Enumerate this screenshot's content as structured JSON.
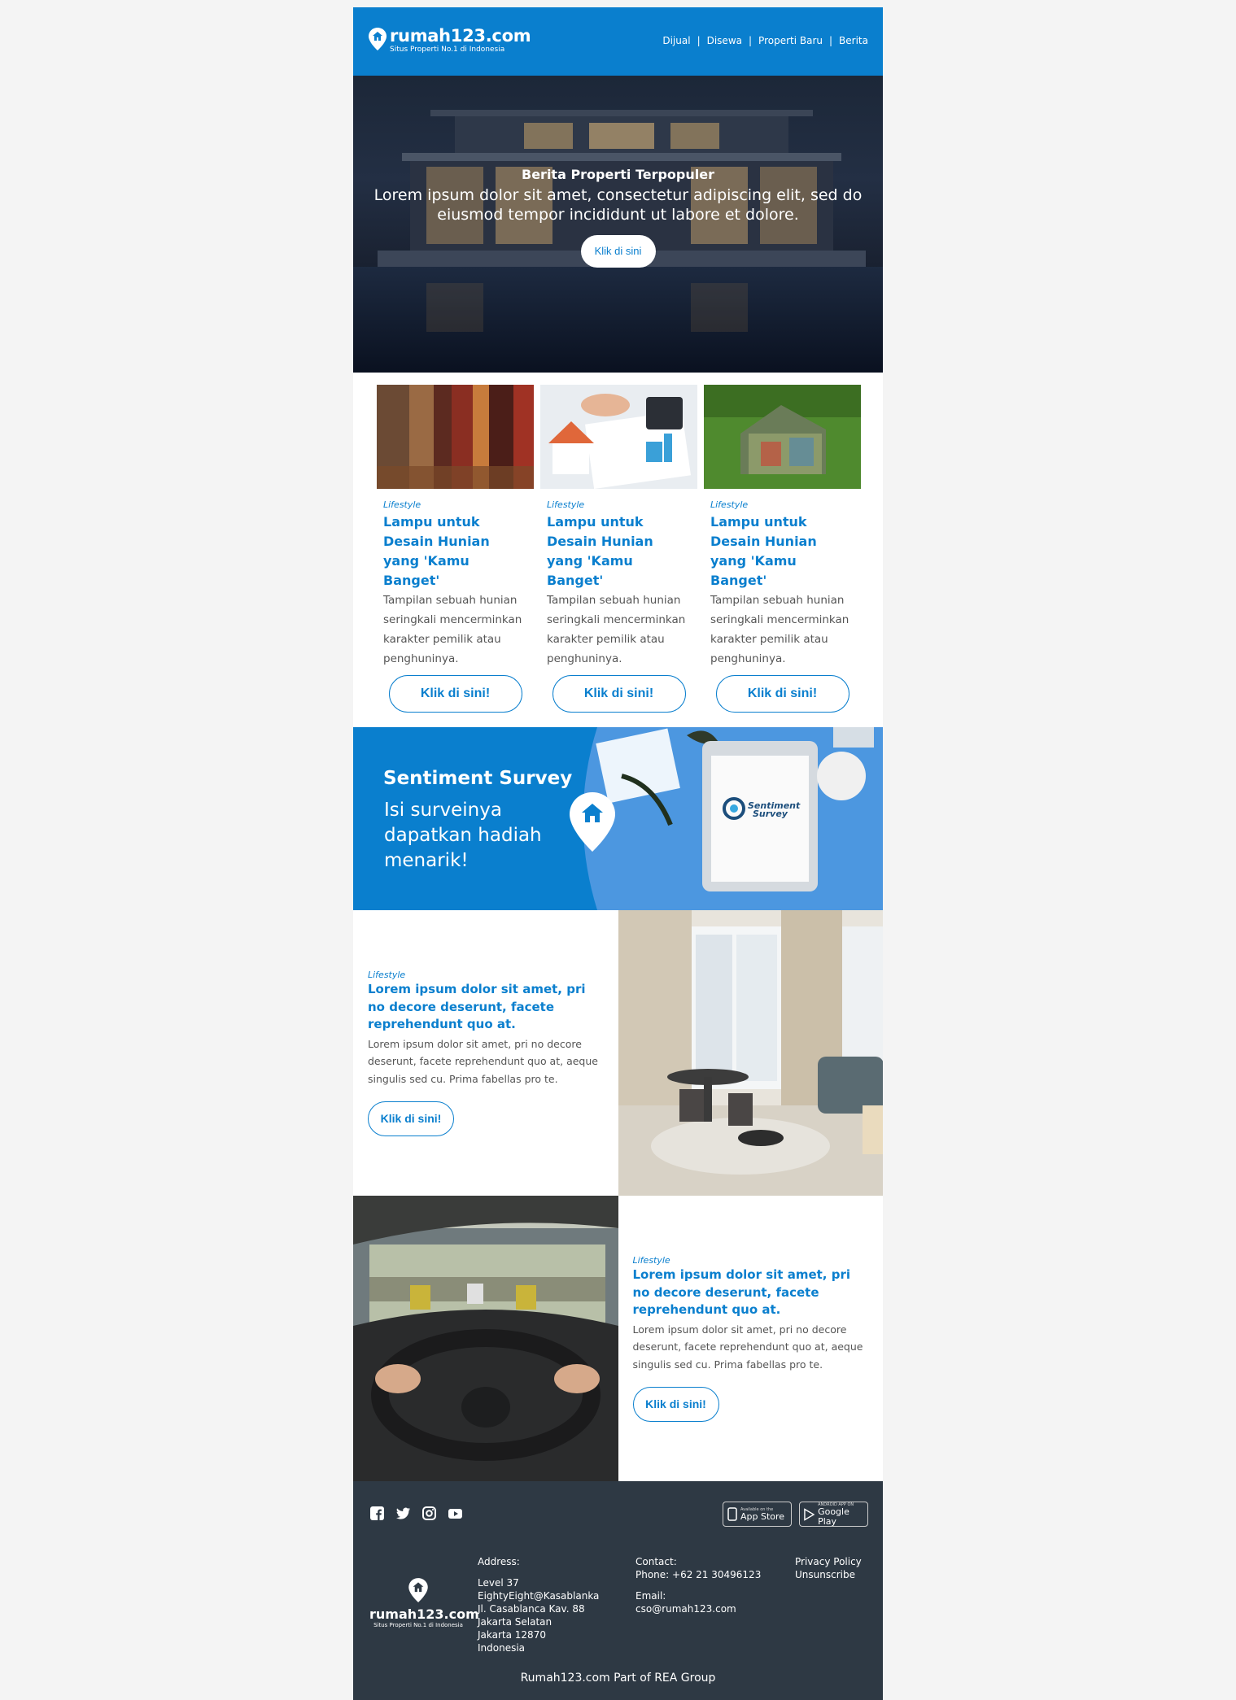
{
  "header": {
    "brand": "rumah123.com",
    "tagline": "Situs Properti No.1 di Indonesia",
    "nav": [
      "Dijual",
      "Disewa",
      "Properti Baru",
      "Berita"
    ],
    "separator": "|"
  },
  "hero": {
    "subtitle": "Berita Properti Terpopuler",
    "body": "Lorem ipsum dolor sit amet, consectetur adipiscing elit, sed do eiusmod tempor incididunt ut labore et dolore.",
    "button": "Klik di sini"
  },
  "articles": [
    {
      "category": "Lifestyle",
      "title": "Lampu untuk Desain Hunian yang 'Kamu Banget'",
      "desc": "Tampilan sebuah hunian seringkali mencerminkan karakter pemilik atau penghuninya.",
      "button": "Klik di sini!"
    },
    {
      "category": "Lifestyle",
      "title": "Lampu untuk Desain Hunian yang 'Kamu Banget'",
      "desc": "Tampilan sebuah hunian seringkali mencerminkan karakter pemilik atau penghuninya.",
      "button": "Klik di sini!"
    },
    {
      "category": "Lifestyle",
      "title": "Lampu untuk Desain Hunian yang 'Kamu Banget'",
      "desc": "Tampilan sebuah hunian seringkali mencerminkan karakter pemilik atau penghuninya.",
      "button": "Klik di sini!"
    }
  ],
  "survey": {
    "title": "Sentiment Survey",
    "text": "Isi surveinya dapatkan hadiah menarik!",
    "logo_text_1": "Sentiment",
    "logo_text_2": "Survey"
  },
  "features": [
    {
      "category": "Lifestyle",
      "title": "Lorem ipsum dolor sit amet, pri no decore deserunt, facete reprehendunt quo at.",
      "desc": "Lorem ipsum dolor sit amet, pri no decore deserunt, facete reprehendunt quo at, aeque singulis sed cu. Prima fabellas pro te.",
      "button": "Klik di sini!"
    },
    {
      "category": "Lifestyle",
      "title": "Lorem ipsum dolor sit amet, pri no decore deserunt, facete reprehendunt quo at.",
      "desc": "Lorem ipsum dolor sit amet, pri no decore deserunt, facete reprehendunt quo at, aeque singulis sed cu. Prima fabellas pro te.",
      "button": "Klik di sini!"
    }
  ],
  "footer": {
    "social_icons": [
      "facebook-icon",
      "twitter-icon",
      "instagram-icon",
      "youtube-icon"
    ],
    "app_store": {
      "small": "Available on the",
      "big": "App Store"
    },
    "google_play": {
      "small": "ANDROID APP ON",
      "big": "Google Play"
    },
    "brand": "rumah123.com",
    "tagline": "Situs Properti No.1 di Indonesia",
    "address_label": "Address:",
    "address_lines": [
      "Level 37",
      "EightyEight@Kasablanka",
      "Jl. Casablanca Kav. 88",
      "Jakarta Selatan",
      "Jakarta 12870",
      "Indonesia"
    ],
    "contact_label": "Contact:",
    "phone": "Phone: +62 21 30496123",
    "email_label": "Email:",
    "email": "cso@rumah123.com",
    "privacy": "Privacy Policy",
    "unsubscribe": "Unsunscribe",
    "bottom": "Rumah123.com Part of REA Group"
  },
  "colors": {
    "brand_blue": "#0a7fce",
    "footer_bg": "#2e3944",
    "page_bg": "#f4f4f4"
  }
}
